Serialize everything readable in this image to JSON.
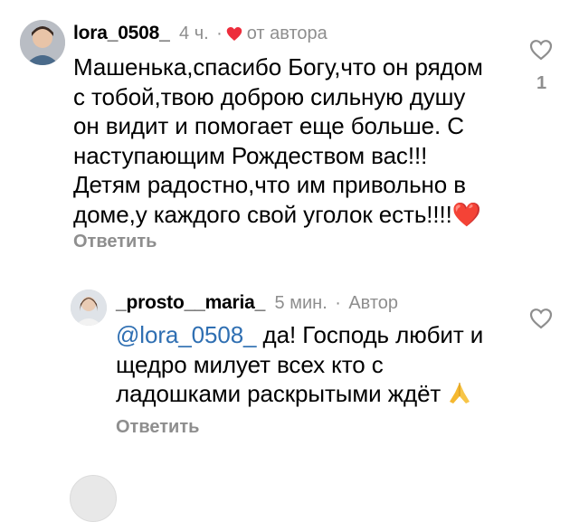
{
  "comments": [
    {
      "username": "lora_0508_",
      "time": "4 ч.",
      "separator": "·",
      "author_tag": "от автора",
      "text": "Машенька,спасибо Богу,что он рядом\nс тобой,твою доброю сильную душу\nон видит и помогает еще больше. С\nнаступающим Рождеством вас!!!\nДетям радостно,что им привольно в\nдоме,у каждого свой уголок есть!!!!",
      "emoji": "❤️",
      "reply_label": "Ответить",
      "like_count": "1",
      "icons": {
        "author_like": "red-heart-icon",
        "like": "heart-outline-icon"
      }
    }
  ],
  "replies": [
    {
      "username": "_prosto__maria_",
      "time": "5 мин.",
      "separator": "·",
      "author_tag": "Автор",
      "mention": "@lora_0508_",
      "text": " да! Господь любит и\nщедро милует всех кто с\nладошками раскрытыми ждёт",
      "emoji": "🙏",
      "reply_label": "Ответить",
      "icons": {
        "like": "heart-outline-icon"
      }
    }
  ],
  "colors": {
    "secondary_text": "#8e8e8e",
    "mention": "#2f6fb2",
    "author_heart": "#ed2d3c"
  }
}
